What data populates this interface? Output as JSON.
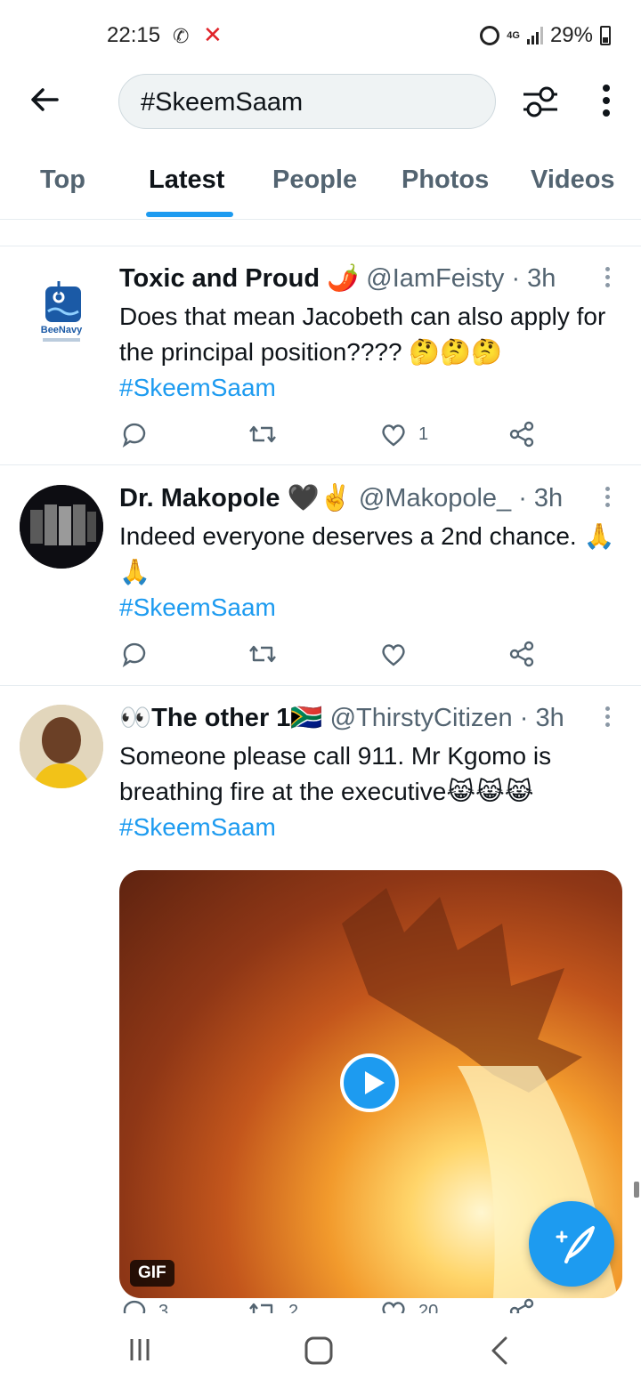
{
  "status_bar": {
    "time": "22:15",
    "network": "4G",
    "battery": "29%"
  },
  "search": {
    "query": "#SkeemSaam"
  },
  "tabs": [
    "Top",
    "Latest",
    "People",
    "Photos",
    "Videos"
  ],
  "tweets": [
    {
      "name": "Toxic and Proud",
      "name_emoji": "🌶️",
      "handle": "@IamFeisty · 3h",
      "avatar_text": "BeeNavy",
      "text": "Does that mean Jacobeth can also apply for the principal position???? 🤔🤔🤔",
      "hashtag": "#SkeemSaam",
      "reply_count": "",
      "retweet_count": "",
      "like_count": "1"
    },
    {
      "name": "Dr. Makopole",
      "name_emoji": "🖤✌️",
      "handle": "@Makopole_ · 3h",
      "text": "Indeed everyone deserves a 2nd chance. 🙏🙏",
      "hashtag": "#SkeemSaam",
      "reply_count": "",
      "retweet_count": "",
      "like_count": ""
    },
    {
      "name_prefix": "👀",
      "name": "The other 1",
      "name_emoji": "🇿🇦",
      "handle": "@ThirstyCitizen · 3h",
      "text": "Someone please call 911. Mr Kgomo is breathing fire at the executive😹😹😹",
      "hashtag": "#SkeemSaam",
      "media_badge": "GIF",
      "reply_count": "3",
      "retweet_count": "2",
      "like_count": "20"
    }
  ],
  "colors": {
    "accent": "#1d9bf0",
    "text": "#0f1419",
    "muted": "#536471"
  }
}
